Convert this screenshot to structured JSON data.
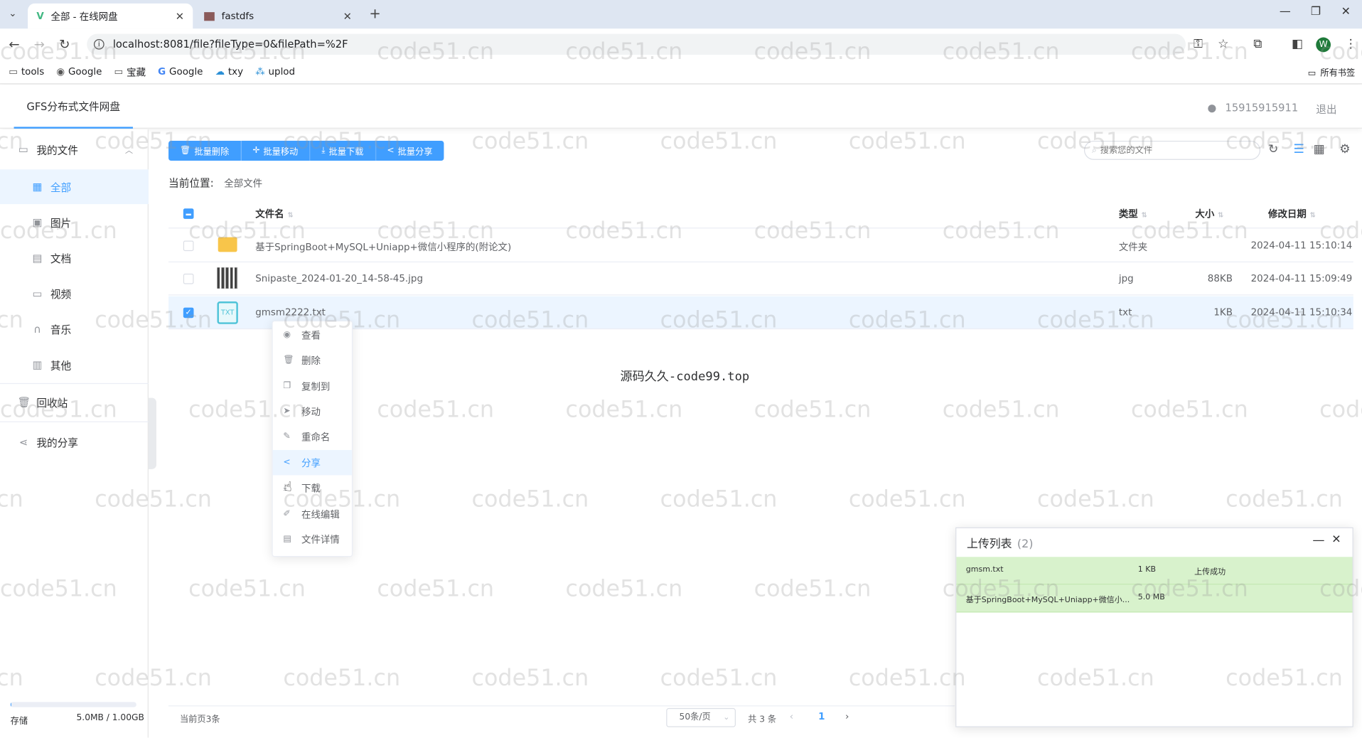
{
  "browser": {
    "tabs": [
      {
        "title": "全部 - 在线网盘",
        "icon": "vue-logo-icon"
      },
      {
        "title": "fastdfs",
        "icon": "image-icon"
      }
    ],
    "url": "localhost:8081/file?fileType=0&filePath=%2F",
    "profile_initial": "W",
    "bookmarks": [
      "tools",
      "Google",
      "宝藏",
      "Google",
      "txy",
      "uplod"
    ],
    "all_bookmarks": "所有书签"
  },
  "app": {
    "brand": "GFS分布式文件网盘",
    "user_phone": "15915915911",
    "logout": "退出"
  },
  "sidebar": {
    "items": [
      {
        "label": "我的文件",
        "icon": "folder-icon"
      },
      {
        "label": "全部",
        "icon": "grid-icon"
      },
      {
        "label": "图片",
        "icon": "image-icon"
      },
      {
        "label": "文档",
        "icon": "document-icon"
      },
      {
        "label": "视频",
        "icon": "video-icon"
      },
      {
        "label": "音乐",
        "icon": "headphones-icon"
      },
      {
        "label": "其他",
        "icon": "box-icon"
      },
      {
        "label": "回收站",
        "icon": "trash-icon"
      },
      {
        "label": "我的分享",
        "icon": "share-icon"
      }
    ],
    "storage_label": "存储",
    "storage_value": "5.0MB / 1.00GB",
    "storage_fraction": 0.005
  },
  "toolbar": {
    "batch_delete": "批量删除",
    "batch_move": "批量移动",
    "batch_download": "批量下载",
    "batch_share": "批量分享",
    "search_placeholder": "搜索您的文件"
  },
  "breadcrumb": {
    "label": "当前位置:",
    "value": "全部文件"
  },
  "table": {
    "headers": {
      "name": "文件名",
      "type": "类型",
      "size": "大小",
      "date": "修改日期"
    },
    "rows": [
      {
        "name": "基于SpringBoot+MySQL+Uniapp+微信小程序的(附论文)",
        "type": "文件夹",
        "size": "",
        "date": "2024-04-11 15:10:14",
        "selected": false
      },
      {
        "name": "Snipaste_2024-01-20_14-58-45.jpg",
        "type": "jpg",
        "size": "88KB",
        "date": "2024-04-11 15:09:49",
        "selected": false
      },
      {
        "name": "gmsm2222.txt",
        "type": "txt",
        "size": "1KB",
        "date": "2024-04-11 15:10:34",
        "selected": true
      }
    ]
  },
  "center_note": "源码久久-code99.top",
  "context_menu": [
    {
      "label": "查看",
      "icon": "eye-icon"
    },
    {
      "label": "删除",
      "icon": "trash-icon"
    },
    {
      "label": "复制到",
      "icon": "copy-icon"
    },
    {
      "label": "移动",
      "icon": "send-icon"
    },
    {
      "label": "重命名",
      "icon": "edit-icon"
    },
    {
      "label": "分享",
      "icon": "share-icon"
    },
    {
      "label": "下载",
      "icon": "download-icon"
    },
    {
      "label": "在线编辑",
      "icon": "pen-icon"
    },
    {
      "label": "文件详情",
      "icon": "info-document-icon"
    }
  ],
  "pagination": {
    "current_count": "当前页3条",
    "page_size": "50条/页",
    "total": "共 3 条",
    "page": "1"
  },
  "upload": {
    "title": "上传列表",
    "count": "(2)",
    "items": [
      {
        "name": "gmsm.txt",
        "size": "1 KB",
        "status": "上传成功"
      },
      {
        "name": "基于SpringBoot+MySQL+Uniapp+微信小...",
        "size": "5.0 MB",
        "status": ""
      }
    ]
  },
  "watermark": "code51.cn",
  "colors": {
    "primary": "#409eff",
    "upload_success": "#d8f2cc"
  }
}
